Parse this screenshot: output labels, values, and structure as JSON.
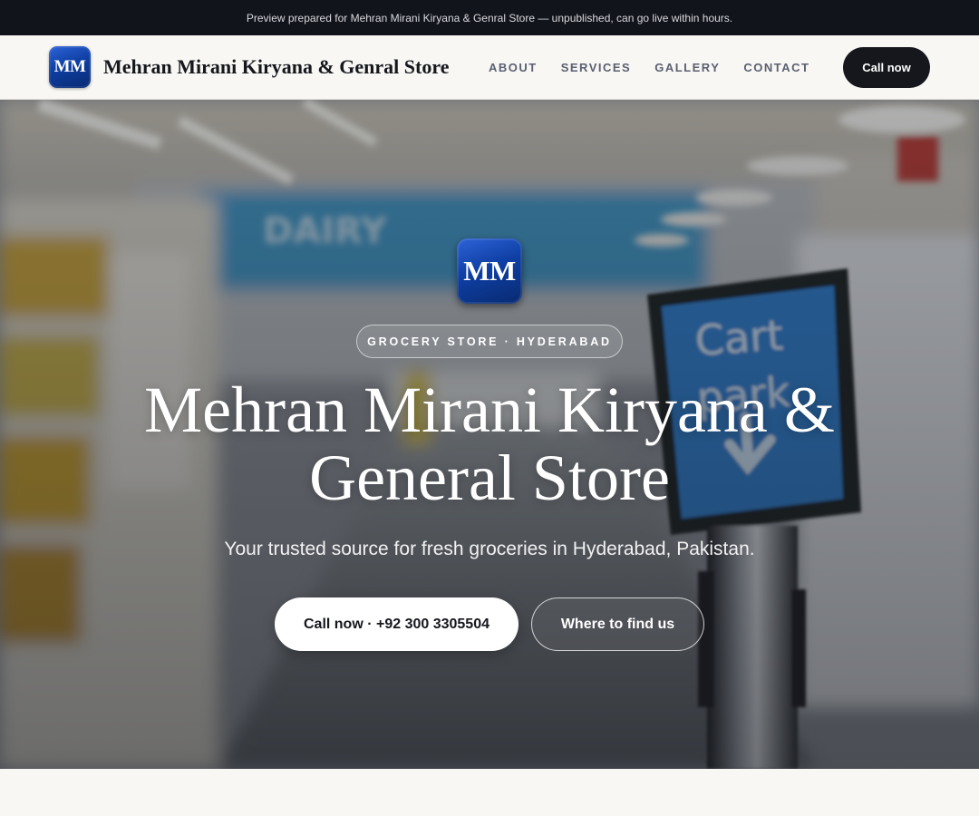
{
  "preview_banner": "Preview prepared for Mehran Mirani Kiryana & Genral Store — unpublished, can go live within hours.",
  "header": {
    "logo_text": "MM",
    "brand_name": "Mehran Mirani Kiryana & Genral Store",
    "nav": [
      {
        "label": "ABOUT"
      },
      {
        "label": "SERVICES"
      },
      {
        "label": "GALLERY"
      },
      {
        "label": "CONTACT"
      }
    ],
    "cta_label": "Call now"
  },
  "hero": {
    "logo_text": "MM",
    "eyebrow": "GROCERY STORE · HYDERABAD",
    "title": "Mehran Mirani Kiryana & General Store",
    "subtitle": "Your trusted source for fresh groceries in Hyderabad, Pakistan.",
    "primary_button": "Call now · +92 300 3305504",
    "secondary_button": "Where to find us",
    "background_icon": "blurred-supermarket-aisle-with-cart-park-sign"
  },
  "colors": {
    "topbar_bg": "#12141b",
    "brand_dark": "#15171c",
    "logo_blue": "#0f3fa4",
    "page_bg": "#f8f7f4"
  }
}
